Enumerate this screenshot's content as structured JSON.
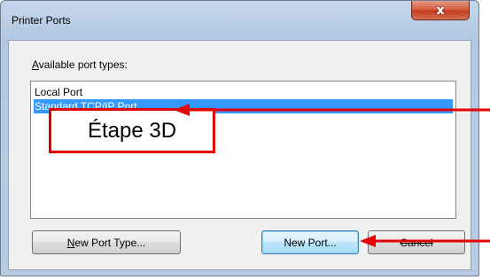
{
  "window": {
    "title": "Printer Ports",
    "close_glyph": "x"
  },
  "dialog": {
    "label_prefix": "A",
    "label_rest": "vailable port types:",
    "list_items": [
      "Local Port",
      "Standard TCP/IP Port"
    ],
    "selected_index": 1,
    "annotation_text": "Étape 3D"
  },
  "buttons": {
    "new_port_type": {
      "prefix": "N",
      "rest": "ew Port Type..."
    },
    "new_port": "New Port...",
    "cancel": "Cancel"
  },
  "colors": {
    "selection": "#3399ff",
    "annotation_red": "#e60000"
  },
  "icons": {
    "close": "close-icon",
    "arrow_to_list": "red-arrow-icon",
    "arrow_to_button": "red-arrow-icon"
  }
}
